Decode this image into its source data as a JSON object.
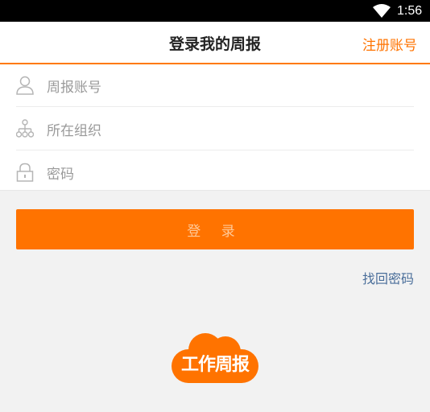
{
  "status_bar": {
    "time": "1:56"
  },
  "header": {
    "title": "登录我的周报",
    "register_label": "注册账号"
  },
  "form": {
    "account_placeholder": "周报账号",
    "organization_placeholder": "所在组织",
    "password_placeholder": "密码"
  },
  "login_label": "登 录",
  "forgot_label": "找回密码",
  "logo": {
    "text": "工作周报"
  },
  "colors": {
    "accent": "#ff7300",
    "link": "#4a6e9a"
  }
}
